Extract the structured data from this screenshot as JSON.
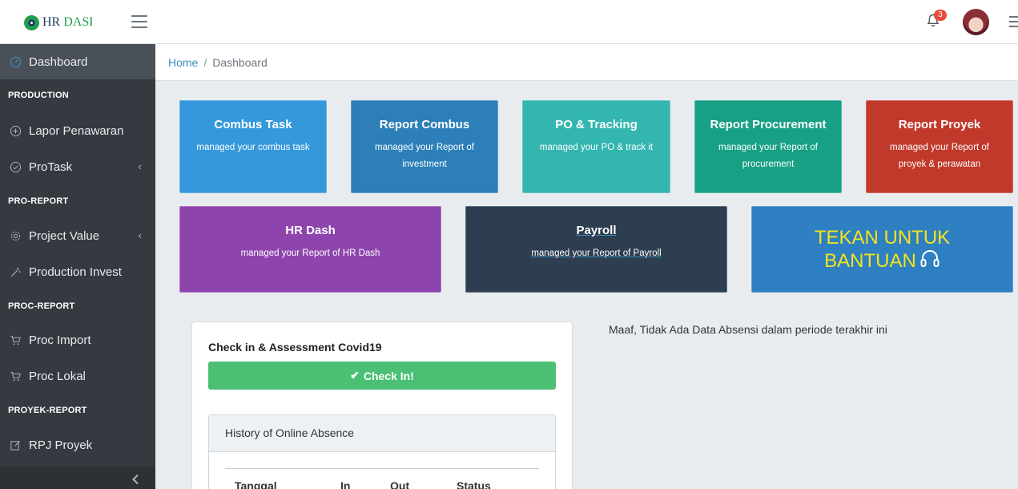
{
  "header": {
    "brand_part1": "HR ",
    "brand_part2": "DASH",
    "notification_count": "3",
    "icons": [
      "menu-icon",
      "bell-icon",
      "avatar",
      "menu-icon"
    ]
  },
  "sidebar": {
    "items": [
      {
        "label": "Dashboard",
        "icon": "dashboard-icon"
      },
      {
        "label": "Lapor Penawaran",
        "icon": "plus-circle-icon"
      },
      {
        "label": "ProTask",
        "icon": "check-circle-icon",
        "caret": "‹"
      },
      {
        "label": "Project Value",
        "icon": "gear-icon",
        "caret": "‹"
      },
      {
        "label": "Production Invest",
        "icon": "wand-icon"
      },
      {
        "label": "Proc Import",
        "icon": "cart-icon"
      },
      {
        "label": "Proc Lokal",
        "icon": "cart-icon"
      },
      {
        "label": "RPJ Proyek",
        "icon": "edit-icon"
      }
    ],
    "headers": [
      "PRODUCTION",
      "PRO-REPORT",
      "PROC-REPORT",
      "PROYEK-REPORT"
    ]
  },
  "breadcrumb": {
    "home": "Home",
    "separator": "/",
    "current": "Dashboard"
  },
  "tiles": [
    {
      "title": "Combus Task",
      "desc": "managed your combus task",
      "color": "#3498db"
    },
    {
      "title": "Report Combus",
      "desc": "managed your Report of investment",
      "color": "#2c7fb8"
    },
    {
      "title": "PO & Tracking",
      "desc": "managed your PO & track it",
      "color": "#33b5b0"
    },
    {
      "title": "Report Procurement",
      "desc": "managed your Report of procurement",
      "color": "#17a085"
    },
    {
      "title": "Report Proyek",
      "desc": "managed your Report of proyek & perawatan",
      "color": "#c0392b"
    },
    {
      "title": "HR Dash",
      "desc": "managed your Report of HR Dash",
      "color": "#8e44ad"
    },
    {
      "title": "Payroll",
      "desc": "managed your Report of Payroll",
      "color": "#2c3e50"
    }
  ],
  "help": {
    "line1": "TEKAN UNTUK",
    "line2": "BANTUAN",
    "icon": "headset-icon",
    "text_color": "#f5e31a"
  },
  "checkin": {
    "title": "Check in & Assessment Covid19",
    "button": "Check In!",
    "button_color": "#4bbf73",
    "history_title": "History of Online Absence",
    "columns": [
      "Tanggal",
      "In",
      "Out",
      "Status"
    ]
  },
  "absence_message": "Maaf, Tidak Ada Data Absensi dalam periode terakhir ini"
}
